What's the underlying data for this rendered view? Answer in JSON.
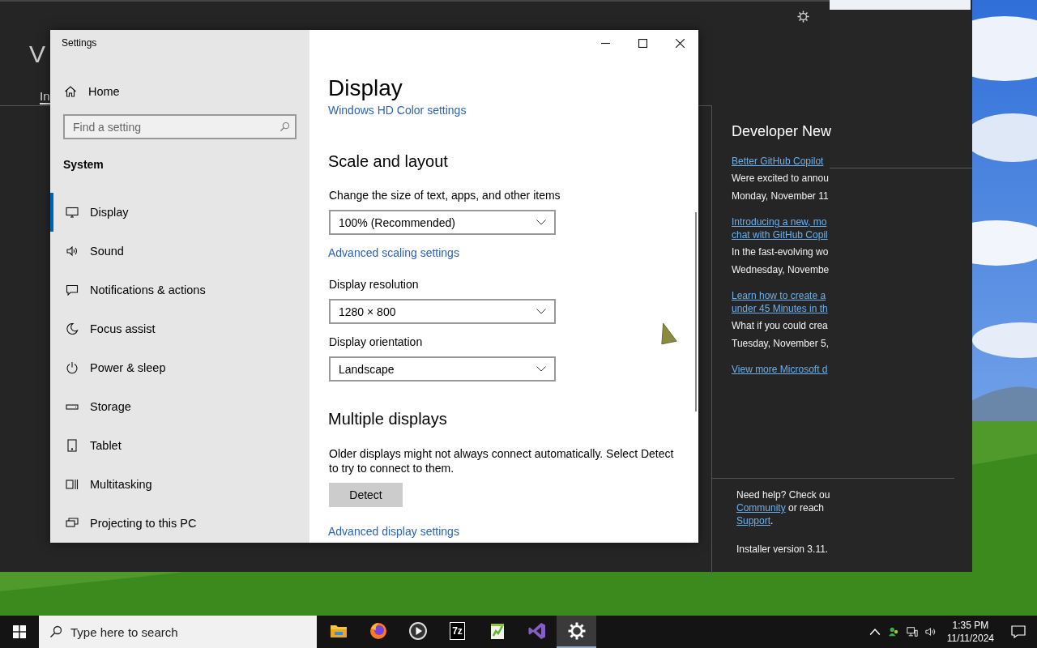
{
  "background_window": {
    "title": "V",
    "tab": "In",
    "news_heading": "Developer New",
    "news": [
      {
        "link": [
          "Better GitHub Copilot"
        ],
        "summary": "Were excited to annou",
        "date": "Monday, November 11"
      },
      {
        "link": [
          "Introducing a new, mo",
          "chat with GitHub Copil"
        ],
        "summary": "In the fast-evolving wo",
        "date": "Wednesday, Novembe"
      },
      {
        "link": [
          "Learn how to create a",
          "under 45 Minutes in th"
        ],
        "summary": "What if you could crea",
        "date": "Tuesday, November 5,"
      }
    ],
    "more_link": "View more Microsoft d",
    "help": {
      "line_1": "Need help? Check ou",
      "community_link": "Community",
      "line_2": " or reach",
      "support_link": "Support",
      "line_3": "."
    },
    "installer_version": "Installer version 3.11."
  },
  "settings": {
    "title": "Settings",
    "home": "Home",
    "search": {
      "placeholder": "Find a setting"
    },
    "section": "System",
    "nav": [
      {
        "label": "Display",
        "kind": "display",
        "selected": true
      },
      {
        "label": "Sound",
        "kind": "sound",
        "selected": false
      },
      {
        "label": "Notifications & actions",
        "kind": "notifications",
        "selected": false
      },
      {
        "label": "Focus assist",
        "kind": "focus",
        "selected": false
      },
      {
        "label": "Power & sleep",
        "kind": "power",
        "selected": false
      },
      {
        "label": "Storage",
        "kind": "storage",
        "selected": false
      },
      {
        "label": "Tablet",
        "kind": "tablet",
        "selected": false
      },
      {
        "label": "Multitasking",
        "kind": "multitasking",
        "selected": false
      },
      {
        "label": "Projecting to this PC",
        "kind": "projecting",
        "selected": false
      }
    ],
    "page_title": "Display",
    "hd_color_link": "Windows HD Color settings",
    "scale_heading": "Scale and layout",
    "scale_label": "Change the size of text, apps, and other items",
    "scale_value": "100% (Recommended)",
    "scale_link": "Advanced scaling settings",
    "resolution_label": "Display resolution",
    "resolution_value": "1280 × 800",
    "orientation_label": "Display orientation",
    "orientation_value": "Landscape",
    "multi_heading": "Multiple displays",
    "multi_text": "Older displays might not always connect automatically. Select Detect to try to connect to them.",
    "detect_button": "Detect",
    "advanced_link": "Advanced display settings"
  },
  "taskbar": {
    "search_placeholder": "Type here to search",
    "apps": [
      {
        "kind": "folder",
        "active": false
      },
      {
        "kind": "firefox",
        "active": false
      },
      {
        "kind": "player",
        "active": false
      },
      {
        "kind": "archiver",
        "label": "7z",
        "active": false
      },
      {
        "kind": "notepad",
        "active": false
      },
      {
        "kind": "studio",
        "active": false
      },
      {
        "kind": "gear",
        "active": true
      }
    ],
    "time": "1:35 PM",
    "date": "11/11/2024"
  }
}
